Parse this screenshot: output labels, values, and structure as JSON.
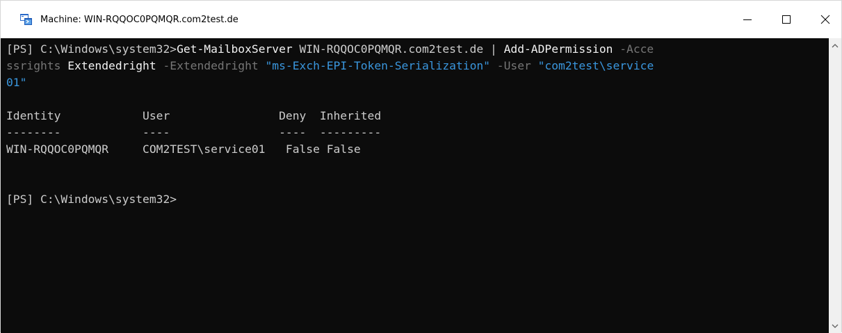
{
  "window": {
    "title": "Machine: WIN-RQQOC0PQMQR.com2test.de",
    "icon": "powershell-window-icon"
  },
  "controls": {
    "minimize_icon": "minimize-icon",
    "maximize_icon": "maximize-icon",
    "close_icon": "close-icon"
  },
  "console": {
    "line1": {
      "prompt": "[PS] C:\\Windows\\system32>",
      "cmd1": "Get-MailboxServer",
      "arg1": " WIN-RQQOC0PQMQR.com2test.de ",
      "pipe": "|",
      "cmd2": " Add-ADPermission",
      "param1a": " -Acce"
    },
    "line2": {
      "param1b": "ssrights",
      "val1": " Extendedright",
      "param2": " -Extendedright",
      "str1": " \"ms-Exch-EPI-Token-Serialization\"",
      "param3": " -User",
      "str2a": " \"com2test\\service"
    },
    "line3": {
      "str2b": "01\""
    },
    "table": {
      "headers": [
        "Identity",
        "User",
        "Deny",
        "Inherited"
      ],
      "separators": [
        "--------",
        "----",
        "----",
        "---------"
      ],
      "header_line": "Identity            User                Deny  Inherited",
      "separator_line": "--------            ----                ----  ---------",
      "rows": [
        {
          "identity": "WIN-RQQOC0PQMQR",
          "user": "COM2TEST\\service01",
          "deny": "False",
          "inherited": "False"
        }
      ],
      "row_line": "WIN-RQQOC0PQMQR     COM2TEST\\service01   False False"
    },
    "final_prompt": "[PS] C:\\Windows\\system32>"
  },
  "colors": {
    "background": "#0c0c0c",
    "foreground": "#cccccc",
    "command": "#f2f2f2",
    "parameter": "#767676",
    "string": "#3a96dd"
  }
}
